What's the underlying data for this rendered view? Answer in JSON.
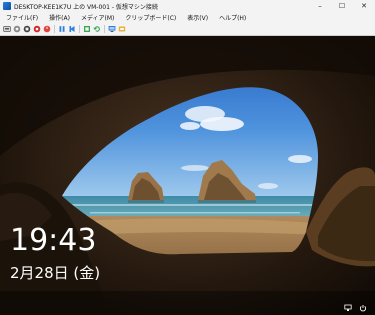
{
  "window": {
    "title": "DESKTOP-KEE1K7U 上の VM-001 - 仮想マシン接続",
    "icon": "hyperv-vm-icon"
  },
  "window_controls": {
    "minimize": "–",
    "maximize": "☐",
    "close": "✕"
  },
  "menu": [
    "ファイル(F)",
    "操作(A)",
    "メディア(M)",
    "クリップボード(C)",
    "表示(V)",
    "ヘルプ(H)"
  ],
  "toolbar": [
    {
      "icon": "ctrl-alt-del-icon"
    },
    {
      "icon": "start-icon"
    },
    {
      "icon": "turn-off-icon"
    },
    {
      "icon": "shutdown-icon"
    },
    {
      "icon": "power-icon"
    },
    {
      "icon": "pause-icon"
    },
    {
      "icon": "reset-icon"
    },
    {
      "icon": "checkpoint-icon"
    },
    {
      "icon": "revert-icon"
    },
    {
      "icon": "enhanced-session-icon"
    },
    {
      "icon": "share-icon"
    }
  ],
  "lockscreen": {
    "time": "19:43",
    "date": "2月28日 (金)"
  },
  "status_icons": [
    "network-icon",
    "power-status-icon"
  ]
}
